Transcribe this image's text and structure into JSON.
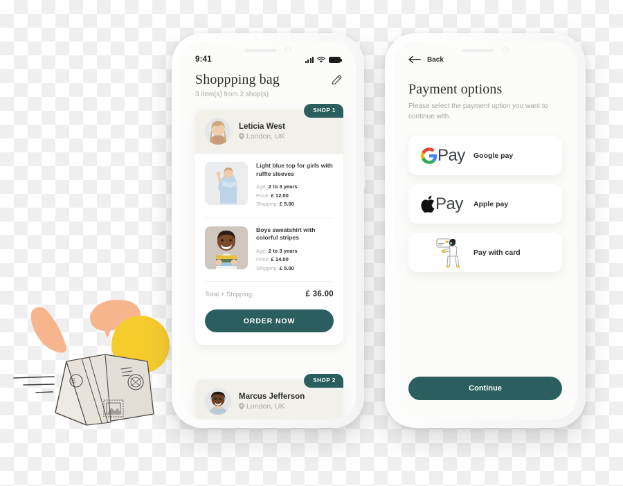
{
  "colors": {
    "accent_teal": "#2b5f5f",
    "shop_header_bg": "#f1f0eb",
    "muted_text": "#a9a9a9",
    "dark_text": "#2e2e2e",
    "card_bg": "#ffffff",
    "screen_bg": "#fbfbfa"
  },
  "left_phone": {
    "status_bar": {
      "time": "9:41",
      "signal_icon": "cellular-bars-icon",
      "wifi_icon": "wifi-icon",
      "battery_icon": "battery-full-icon"
    },
    "header": {
      "title": "Shoppping bag",
      "subtitle": "3 item(s) from 2 shop(s)",
      "edit_icon": "pencil-edit-icon"
    },
    "shops": [
      {
        "badge": "SHOP 1",
        "seller_name": "Leticia West",
        "location": "London, UK",
        "location_icon": "map-pin-icon",
        "avatar_icon": "seller-avatar-woman",
        "products": [
          {
            "name": "Light blue top for girls with ruffle sleeves",
            "thumb_icon": "product-photo-girl-blue-top",
            "age_label": "Age:",
            "age_value": "2 to 3 years",
            "price_label": "Price:",
            "price_value": "£ 12.00",
            "shipping_label": "Shipping:",
            "shipping_value": "£ 5.00"
          },
          {
            "name": "Boys sweatshirt with colorful stripes",
            "thumb_icon": "product-photo-boy-striped-sweatshirt",
            "age_label": "Age:",
            "age_value": "2 to 3 years",
            "price_label": "Price:",
            "price_value": "£ 14.00",
            "shipping_label": "Shipping:",
            "shipping_value": "£ 5.00"
          }
        ],
        "total_label": "Total + Shipping:",
        "total_value": "£  36.00",
        "order_button": "ORDER NOW"
      },
      {
        "badge": "SHOP 2",
        "seller_name": "Marcus Jefferson",
        "location": "London, UK",
        "location_icon": "map-pin-icon",
        "avatar_icon": "seller-avatar-man"
      }
    ]
  },
  "right_phone": {
    "back": {
      "label": "Back",
      "icon": "arrow-left-icon"
    },
    "header": {
      "title": "Payment options",
      "description": "Please select the payment option you want to continue with."
    },
    "payment_options": [
      {
        "id": "google-pay",
        "logo_icon": "google-g-icon",
        "logo_word": "Pay",
        "label": "Google pay"
      },
      {
        "id": "apple-pay",
        "logo_icon": "apple-logo-icon",
        "logo_word": "Pay",
        "label": "Apple pay"
      },
      {
        "id": "pay-with-card",
        "logo_icon": "person-holding-card-illustration",
        "logo_word": "",
        "label": "Pay with card"
      }
    ],
    "continue_button": "Continue"
  },
  "decoration": {
    "parcel_icon": "cardboard-parcel-illustration",
    "blob_icons": [
      "peach-blob",
      "peach-triangle",
      "yellow-circle",
      "speed-lines"
    ]
  }
}
